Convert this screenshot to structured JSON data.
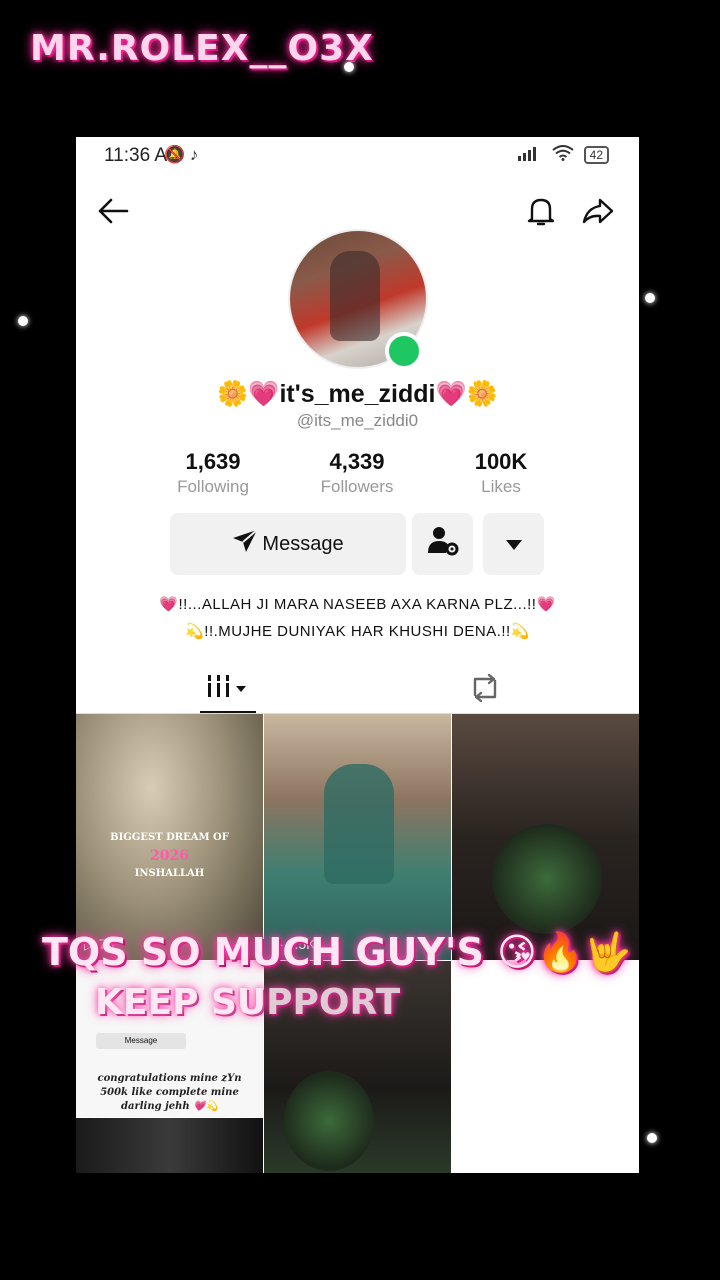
{
  "watermark": "MR.ROLEX__O3X",
  "status": {
    "time": "11:36 AM",
    "icons": "🔕 ♪",
    "signal": "📶",
    "battery": "42"
  },
  "profile": {
    "display_name": "🌼💗it's_me_ziddi💗🌼",
    "username": "@its_me_ziddi0",
    "stats": [
      {
        "value": "1,639",
        "label": "Following"
      },
      {
        "value": "4,339",
        "label": "Followers"
      },
      {
        "value": "100K",
        "label": "Likes"
      }
    ],
    "message_label": "Message",
    "bio_lines": [
      "💗!!...ALLAH JI MARA NASEEB AXA KARNA PLZ...!!💗",
      "💫!!.MUJHE DUNIYAK HAR KHUSHI DENA.!!💫"
    ]
  },
  "videos": [
    {
      "caption_line1": "BIGGEST DREAM OF",
      "caption_year": "2026",
      "caption_line3": "INSHALLAH",
      "views": "▷ 78"
    },
    {
      "views": "▷ 1.5K"
    },
    {
      "views": ""
    }
  ],
  "mini_screenshot": {
    "message_label": "Message",
    "lines": [
      "congratulations mine zYn",
      "500k like complete mine",
      "darling jehh 💗💫"
    ]
  },
  "overlay": {
    "line1": "TQS SO MUCH GUY'S 😘🔥🤟",
    "line2": "KEEP SUPPORT"
  },
  "colors": {
    "online": "#1ec761",
    "glow": "#ff3aa6"
  }
}
